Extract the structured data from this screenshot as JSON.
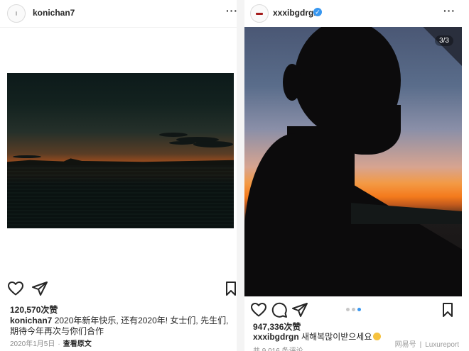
{
  "left_post": {
    "username": "konichan7",
    "more_label": "···",
    "likes": "120,570次赞",
    "caption_user": "konichan7",
    "caption_text": "2020年新年快乐, 还有2020年! 女士们, 先生们, 期待今年再次与你们合作",
    "date": "2020年1月5日",
    "date_separator": "·",
    "translate_label": "查看原文",
    "icons": [
      "heart-icon",
      "share-icon",
      "bookmark-icon"
    ]
  },
  "right_post": {
    "username": "xxxibgdrgn",
    "verified": true,
    "more_label": "···",
    "slide_counter": "3/3",
    "carousel": {
      "total": 3,
      "active": 3
    },
    "likes": "947,336次赞",
    "caption_user": "xxxibgdrgn",
    "caption_text": "새해복많이받으세요",
    "comments_count": "共 9,016 条评论",
    "icons": [
      "heart-icon",
      "comment-icon",
      "share-icon",
      "bookmark-icon",
      "sun-emoji-icon"
    ]
  },
  "watermark": {
    "left": "网易号",
    "separator": "|",
    "right": "Luxureport"
  },
  "colors": {
    "verified": "#3897f0",
    "text": "#262626",
    "muted": "#8e8e8e",
    "sunset_orange": "#f47a1c"
  }
}
